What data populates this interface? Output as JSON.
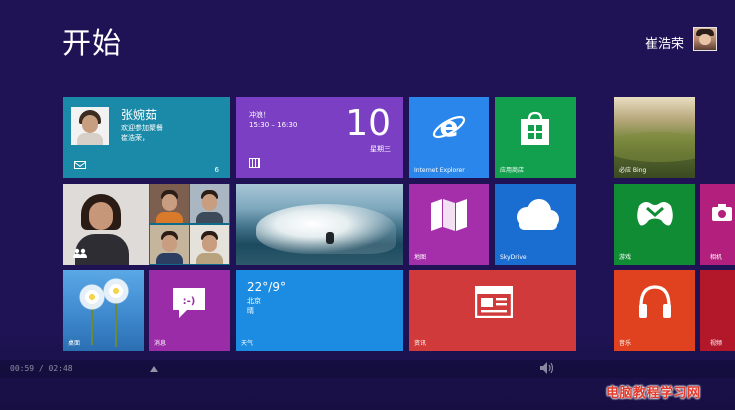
{
  "header": {
    "title": "开始",
    "user_name": "崔浩荣"
  },
  "tiles": {
    "people": {
      "name": "张婉茹",
      "message_line1": "欢迎参加聚餐",
      "message_line2": "崔浩荣，",
      "count": "6"
    },
    "calendar": {
      "event_line1": "冲浪！",
      "event_line2": "15:30 – 16:30",
      "day": "10",
      "weekday": "星期三"
    },
    "ie": {
      "label": "Internet Explorer"
    },
    "store": {
      "label": "应用商店"
    },
    "bing": {
      "label": "必应 Bing"
    },
    "maps": {
      "label": "地图"
    },
    "skydrive": {
      "label": "SkyDrive"
    },
    "games": {
      "label": "游戏"
    },
    "camera": {
      "label": "相机"
    },
    "desktop": {
      "label": "桌面"
    },
    "messaging": {
      "label": "消息"
    },
    "weather": {
      "temp": "22°/9°",
      "city": "北京",
      "condition": "晴",
      "label": "天气"
    },
    "news": {
      "label": "资讯"
    },
    "music": {
      "label": "音乐"
    },
    "video": {
      "label": "视频"
    }
  },
  "player": {
    "timecode": "00:59 / 02:48"
  },
  "watermark": "电脑教程学习网",
  "colors": {
    "background": "#1f1355",
    "people": "#1b8aa8",
    "calendar": "#7b3fc4",
    "ie": "#2a86ea",
    "store": "#12a04e",
    "maps": "#a52fab",
    "skydrive": "#1a6ed1",
    "games": "#108c34",
    "camera": "#b21f7d",
    "messaging": "#9b2ca8",
    "weather": "#1c8ce3",
    "news": "#d13a3a",
    "music": "#e0421f",
    "video": "#b3172a"
  }
}
